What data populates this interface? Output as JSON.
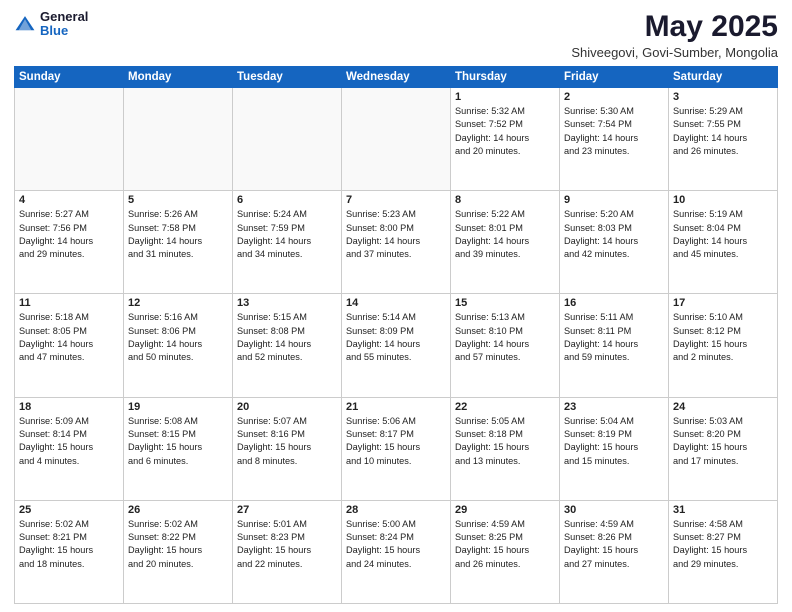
{
  "logo": {
    "general": "General",
    "blue": "Blue"
  },
  "header": {
    "month": "May 2025",
    "location": "Shiveegovi, Govi-Sumber, Mongolia"
  },
  "weekdays": [
    "Sunday",
    "Monday",
    "Tuesday",
    "Wednesday",
    "Thursday",
    "Friday",
    "Saturday"
  ],
  "weeks": [
    [
      {
        "day": "",
        "info": ""
      },
      {
        "day": "",
        "info": ""
      },
      {
        "day": "",
        "info": ""
      },
      {
        "day": "",
        "info": ""
      },
      {
        "day": "1",
        "info": "Sunrise: 5:32 AM\nSunset: 7:52 PM\nDaylight: 14 hours\nand 20 minutes."
      },
      {
        "day": "2",
        "info": "Sunrise: 5:30 AM\nSunset: 7:54 PM\nDaylight: 14 hours\nand 23 minutes."
      },
      {
        "day": "3",
        "info": "Sunrise: 5:29 AM\nSunset: 7:55 PM\nDaylight: 14 hours\nand 26 minutes."
      }
    ],
    [
      {
        "day": "4",
        "info": "Sunrise: 5:27 AM\nSunset: 7:56 PM\nDaylight: 14 hours\nand 29 minutes."
      },
      {
        "day": "5",
        "info": "Sunrise: 5:26 AM\nSunset: 7:58 PM\nDaylight: 14 hours\nand 31 minutes."
      },
      {
        "day": "6",
        "info": "Sunrise: 5:24 AM\nSunset: 7:59 PM\nDaylight: 14 hours\nand 34 minutes."
      },
      {
        "day": "7",
        "info": "Sunrise: 5:23 AM\nSunset: 8:00 PM\nDaylight: 14 hours\nand 37 minutes."
      },
      {
        "day": "8",
        "info": "Sunrise: 5:22 AM\nSunset: 8:01 PM\nDaylight: 14 hours\nand 39 minutes."
      },
      {
        "day": "9",
        "info": "Sunrise: 5:20 AM\nSunset: 8:03 PM\nDaylight: 14 hours\nand 42 minutes."
      },
      {
        "day": "10",
        "info": "Sunrise: 5:19 AM\nSunset: 8:04 PM\nDaylight: 14 hours\nand 45 minutes."
      }
    ],
    [
      {
        "day": "11",
        "info": "Sunrise: 5:18 AM\nSunset: 8:05 PM\nDaylight: 14 hours\nand 47 minutes."
      },
      {
        "day": "12",
        "info": "Sunrise: 5:16 AM\nSunset: 8:06 PM\nDaylight: 14 hours\nand 50 minutes."
      },
      {
        "day": "13",
        "info": "Sunrise: 5:15 AM\nSunset: 8:08 PM\nDaylight: 14 hours\nand 52 minutes."
      },
      {
        "day": "14",
        "info": "Sunrise: 5:14 AM\nSunset: 8:09 PM\nDaylight: 14 hours\nand 55 minutes."
      },
      {
        "day": "15",
        "info": "Sunrise: 5:13 AM\nSunset: 8:10 PM\nDaylight: 14 hours\nand 57 minutes."
      },
      {
        "day": "16",
        "info": "Sunrise: 5:11 AM\nSunset: 8:11 PM\nDaylight: 14 hours\nand 59 minutes."
      },
      {
        "day": "17",
        "info": "Sunrise: 5:10 AM\nSunset: 8:12 PM\nDaylight: 15 hours\nand 2 minutes."
      }
    ],
    [
      {
        "day": "18",
        "info": "Sunrise: 5:09 AM\nSunset: 8:14 PM\nDaylight: 15 hours\nand 4 minutes."
      },
      {
        "day": "19",
        "info": "Sunrise: 5:08 AM\nSunset: 8:15 PM\nDaylight: 15 hours\nand 6 minutes."
      },
      {
        "day": "20",
        "info": "Sunrise: 5:07 AM\nSunset: 8:16 PM\nDaylight: 15 hours\nand 8 minutes."
      },
      {
        "day": "21",
        "info": "Sunrise: 5:06 AM\nSunset: 8:17 PM\nDaylight: 15 hours\nand 10 minutes."
      },
      {
        "day": "22",
        "info": "Sunrise: 5:05 AM\nSunset: 8:18 PM\nDaylight: 15 hours\nand 13 minutes."
      },
      {
        "day": "23",
        "info": "Sunrise: 5:04 AM\nSunset: 8:19 PM\nDaylight: 15 hours\nand 15 minutes."
      },
      {
        "day": "24",
        "info": "Sunrise: 5:03 AM\nSunset: 8:20 PM\nDaylight: 15 hours\nand 17 minutes."
      }
    ],
    [
      {
        "day": "25",
        "info": "Sunrise: 5:02 AM\nSunset: 8:21 PM\nDaylight: 15 hours\nand 18 minutes."
      },
      {
        "day": "26",
        "info": "Sunrise: 5:02 AM\nSunset: 8:22 PM\nDaylight: 15 hours\nand 20 minutes."
      },
      {
        "day": "27",
        "info": "Sunrise: 5:01 AM\nSunset: 8:23 PM\nDaylight: 15 hours\nand 22 minutes."
      },
      {
        "day": "28",
        "info": "Sunrise: 5:00 AM\nSunset: 8:24 PM\nDaylight: 15 hours\nand 24 minutes."
      },
      {
        "day": "29",
        "info": "Sunrise: 4:59 AM\nSunset: 8:25 PM\nDaylight: 15 hours\nand 26 minutes."
      },
      {
        "day": "30",
        "info": "Sunrise: 4:59 AM\nSunset: 8:26 PM\nDaylight: 15 hours\nand 27 minutes."
      },
      {
        "day": "31",
        "info": "Sunrise: 4:58 AM\nSunset: 8:27 PM\nDaylight: 15 hours\nand 29 minutes."
      }
    ]
  ]
}
